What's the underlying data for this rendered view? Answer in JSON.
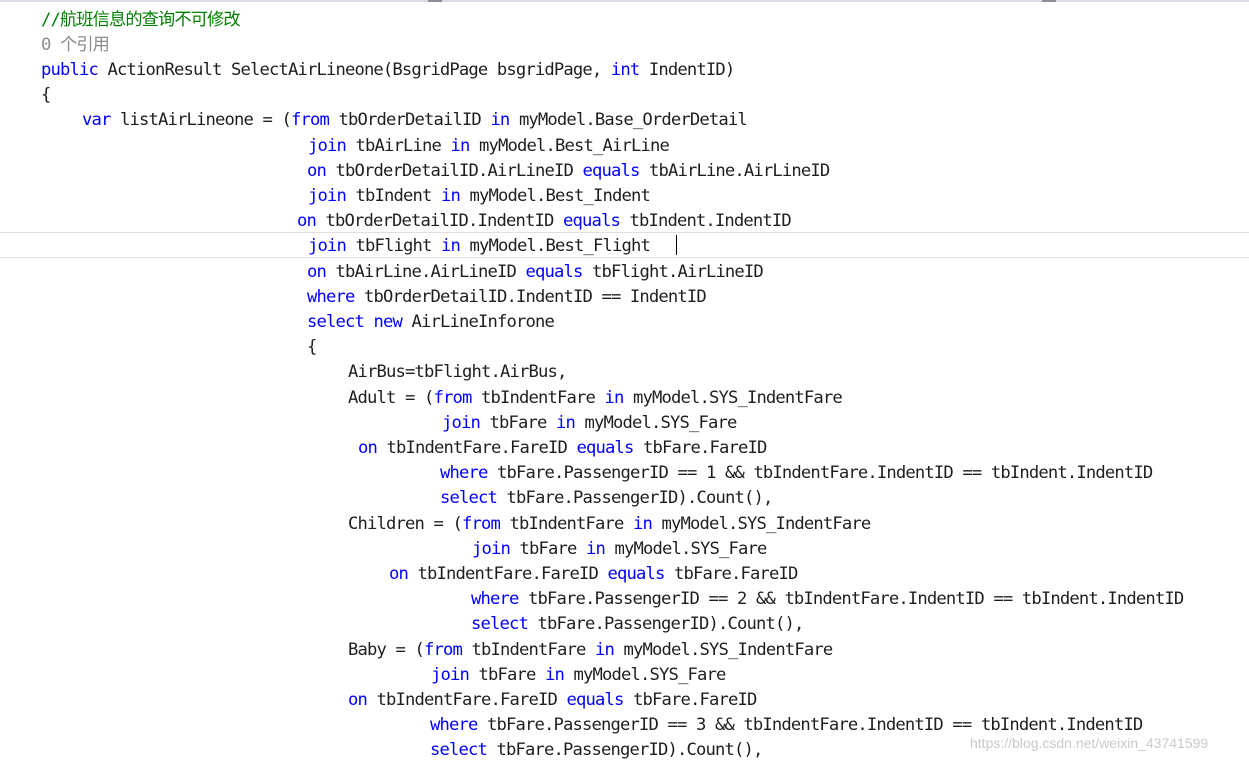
{
  "editor": {
    "comment": "//航班信息的查询不可修改",
    "references": "0 个引用",
    "lines": [
      [
        [
          "kw",
          "public"
        ],
        [
          "",
          "ActionResult SelectAirLineone(BsgridPage bsgridPage,"
        ],
        [
          "kw",
          "int"
        ],
        [
          "",
          "IndentID)"
        ]
      ],
      [
        [
          "",
          "{"
        ]
      ],
      [
        [
          "kw",
          "var"
        ],
        [
          "",
          "listAirLineone = ("
        ],
        [
          "kw",
          "from"
        ],
        [
          "",
          "tbOrderDetailID"
        ],
        [
          "kw",
          "in"
        ],
        [
          "",
          "myModel.Base_OrderDetail"
        ]
      ],
      [
        [
          "kw",
          "join"
        ],
        [
          "",
          "tbAirLine"
        ],
        [
          "kw",
          "in"
        ],
        [
          "",
          "myModel.Best_AirLine"
        ]
      ],
      [
        [
          "kw",
          "on"
        ],
        [
          "",
          "tbOrderDetailID.AirLineID"
        ],
        [
          "kw",
          "equals"
        ],
        [
          "",
          "tbAirLine.AirLineID"
        ]
      ],
      [
        [
          "kw",
          "join"
        ],
        [
          "",
          "tbIndent"
        ],
        [
          "kw",
          "in"
        ],
        [
          "",
          "myModel.Best_Indent"
        ]
      ],
      [
        [
          "kw",
          "on"
        ],
        [
          "",
          "tbOrderDetailID.IndentID"
        ],
        [
          "kw",
          "equals"
        ],
        [
          "",
          "tbIndent.IndentID"
        ]
      ],
      [
        [
          "kw",
          "join"
        ],
        [
          "",
          "tbFlight"
        ],
        [
          "kw",
          "in"
        ],
        [
          "",
          "myModel.Best_Flight"
        ]
      ],
      [
        [
          "kw",
          "on"
        ],
        [
          "",
          "tbAirLine.AirLineID"
        ],
        [
          "kw",
          "equals"
        ],
        [
          "",
          "tbFlight.AirLineID"
        ]
      ],
      [
        [
          "kw",
          "where"
        ],
        [
          "",
          "tbOrderDetailID.IndentID == IndentID"
        ]
      ],
      [
        [
          "kw",
          "select"
        ],
        [
          "kw",
          "new"
        ],
        [
          "",
          "AirLineInforone"
        ]
      ],
      [
        [
          "",
          "{"
        ]
      ],
      [
        [
          "",
          "AirBus=tbFlight.AirBus,"
        ]
      ],
      [
        [
          "",
          "Adult = ("
        ],
        [
          "kw",
          "from"
        ],
        [
          "",
          "tbIndentFare"
        ],
        [
          "kw",
          "in"
        ],
        [
          "",
          "myModel.SYS_IndentFare"
        ]
      ],
      [
        [
          "kw",
          "join"
        ],
        [
          "",
          "tbFare"
        ],
        [
          "kw",
          "in"
        ],
        [
          "",
          "myModel.SYS_Fare"
        ]
      ],
      [
        [
          "kw",
          "on"
        ],
        [
          "",
          "tbIndentFare.FareID"
        ],
        [
          "kw",
          "equals"
        ],
        [
          "",
          "tbFare.FareID"
        ]
      ],
      [
        [
          "kw",
          "where"
        ],
        [
          "",
          "tbFare.PassengerID == 1 && tbIndentFare.IndentID == tbIndent.IndentID"
        ]
      ],
      [
        [
          "kw",
          "select"
        ],
        [
          "",
          "tbFare.PassengerID).Count(),"
        ]
      ],
      [
        [
          "",
          "Children = ("
        ],
        [
          "kw",
          "from"
        ],
        [
          "",
          "tbIndentFare"
        ],
        [
          "kw",
          "in"
        ],
        [
          "",
          "myModel.SYS_IndentFare"
        ]
      ],
      [
        [
          "kw",
          "join"
        ],
        [
          "",
          "tbFare"
        ],
        [
          "kw",
          "in"
        ],
        [
          "",
          "myModel.SYS_Fare"
        ]
      ],
      [
        [
          "kw",
          "on"
        ],
        [
          "",
          "tbIndentFare.FareID"
        ],
        [
          "kw",
          "equals"
        ],
        [
          "",
          "tbFare.FareID"
        ]
      ],
      [
        [
          "kw",
          "where"
        ],
        [
          "",
          "tbFare.PassengerID == 2 && tbIndentFare.IndentID == tbIndent.IndentID"
        ]
      ],
      [
        [
          "kw",
          "select"
        ],
        [
          "",
          "tbFare.PassengerID).Count(),"
        ]
      ],
      [
        [
          "",
          "Baby = ("
        ],
        [
          "kw",
          "from"
        ],
        [
          "",
          "tbIndentFare"
        ],
        [
          "kw",
          "in"
        ],
        [
          "",
          "myModel.SYS_IndentFare"
        ]
      ],
      [
        [
          "kw",
          "join"
        ],
        [
          "",
          "tbFare"
        ],
        [
          "kw",
          "in"
        ],
        [
          "",
          "myModel.SYS_Fare"
        ]
      ],
      [
        [
          "kw",
          "on"
        ],
        [
          "",
          "tbIndentFare.FareID"
        ],
        [
          "kw",
          "equals"
        ],
        [
          "",
          "tbFare.FareID"
        ]
      ],
      [
        [
          "kw",
          "where"
        ],
        [
          "",
          "tbFare.PassengerID == 3 && tbIndentFare.IndentID == tbIndent.IndentID"
        ]
      ],
      [
        [
          "kw",
          "select"
        ],
        [
          "",
          "tbFare.PassengerID).Count(),"
        ]
      ]
    ]
  },
  "watermark": "https://blog.csdn.net/weixin_43741599",
  "colors": {
    "keyword": "#0000ff",
    "comment": "#008000",
    "text": "#1e1e1e",
    "codelens": "#8c8c8c"
  }
}
